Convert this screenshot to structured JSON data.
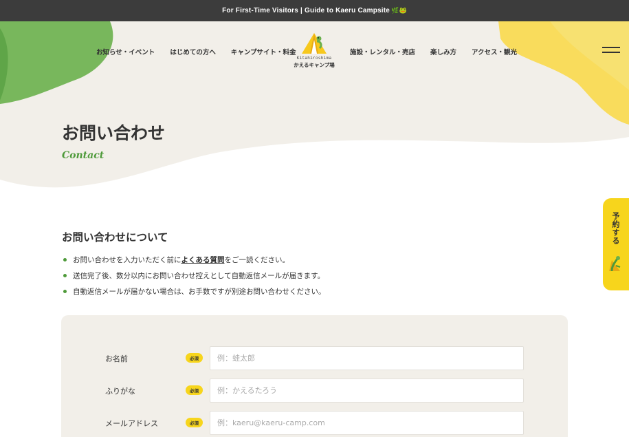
{
  "topbar": {
    "text": "For First-Time Visitors | Guide to Kaeru Campsite",
    "emoji": "🌿🐸"
  },
  "nav": {
    "left": [
      "お知らせ・イベント",
      "はじめての方へ",
      "キャンプサイト・料金"
    ],
    "right": [
      "施設・レンタル・売店",
      "楽しみ方",
      "アクセス・観光"
    ]
  },
  "logo": {
    "sub": "Kitahiroshima",
    "main": "かえるキャンプ場"
  },
  "header": {
    "title": "お問い合わせ",
    "subtitle": "Contact"
  },
  "reserve": {
    "label": "予約する"
  },
  "about": {
    "title": "お問い合わせについて",
    "notes": [
      {
        "before": "お問い合わせを入力いただく前に",
        "link": "よくある質問",
        "after": "をご一読ください。"
      },
      {
        "text": "送信完了後、数分以内にお問い合わせ控えとして自動返信メールが届きます。"
      },
      {
        "text": "自動返信メールが届かない場合は、お手数ですが別途お問い合わせください。"
      }
    ]
  },
  "form": {
    "required_label": "必須",
    "fields": [
      {
        "label": "お名前",
        "placeholder": "例：蛙太郎",
        "value": ""
      },
      {
        "label": "ふりがな",
        "placeholder": "例：かえるたろう",
        "value": ""
      },
      {
        "label": "メールアドレス",
        "placeholder": "例：kaeru@kaeru-camp.com",
        "value": ""
      }
    ]
  },
  "colors": {
    "accent_green": "#4e9a3a",
    "accent_yellow": "#f7d51c",
    "beige": "#f2efe9",
    "topbar": "#3c3c3c"
  }
}
